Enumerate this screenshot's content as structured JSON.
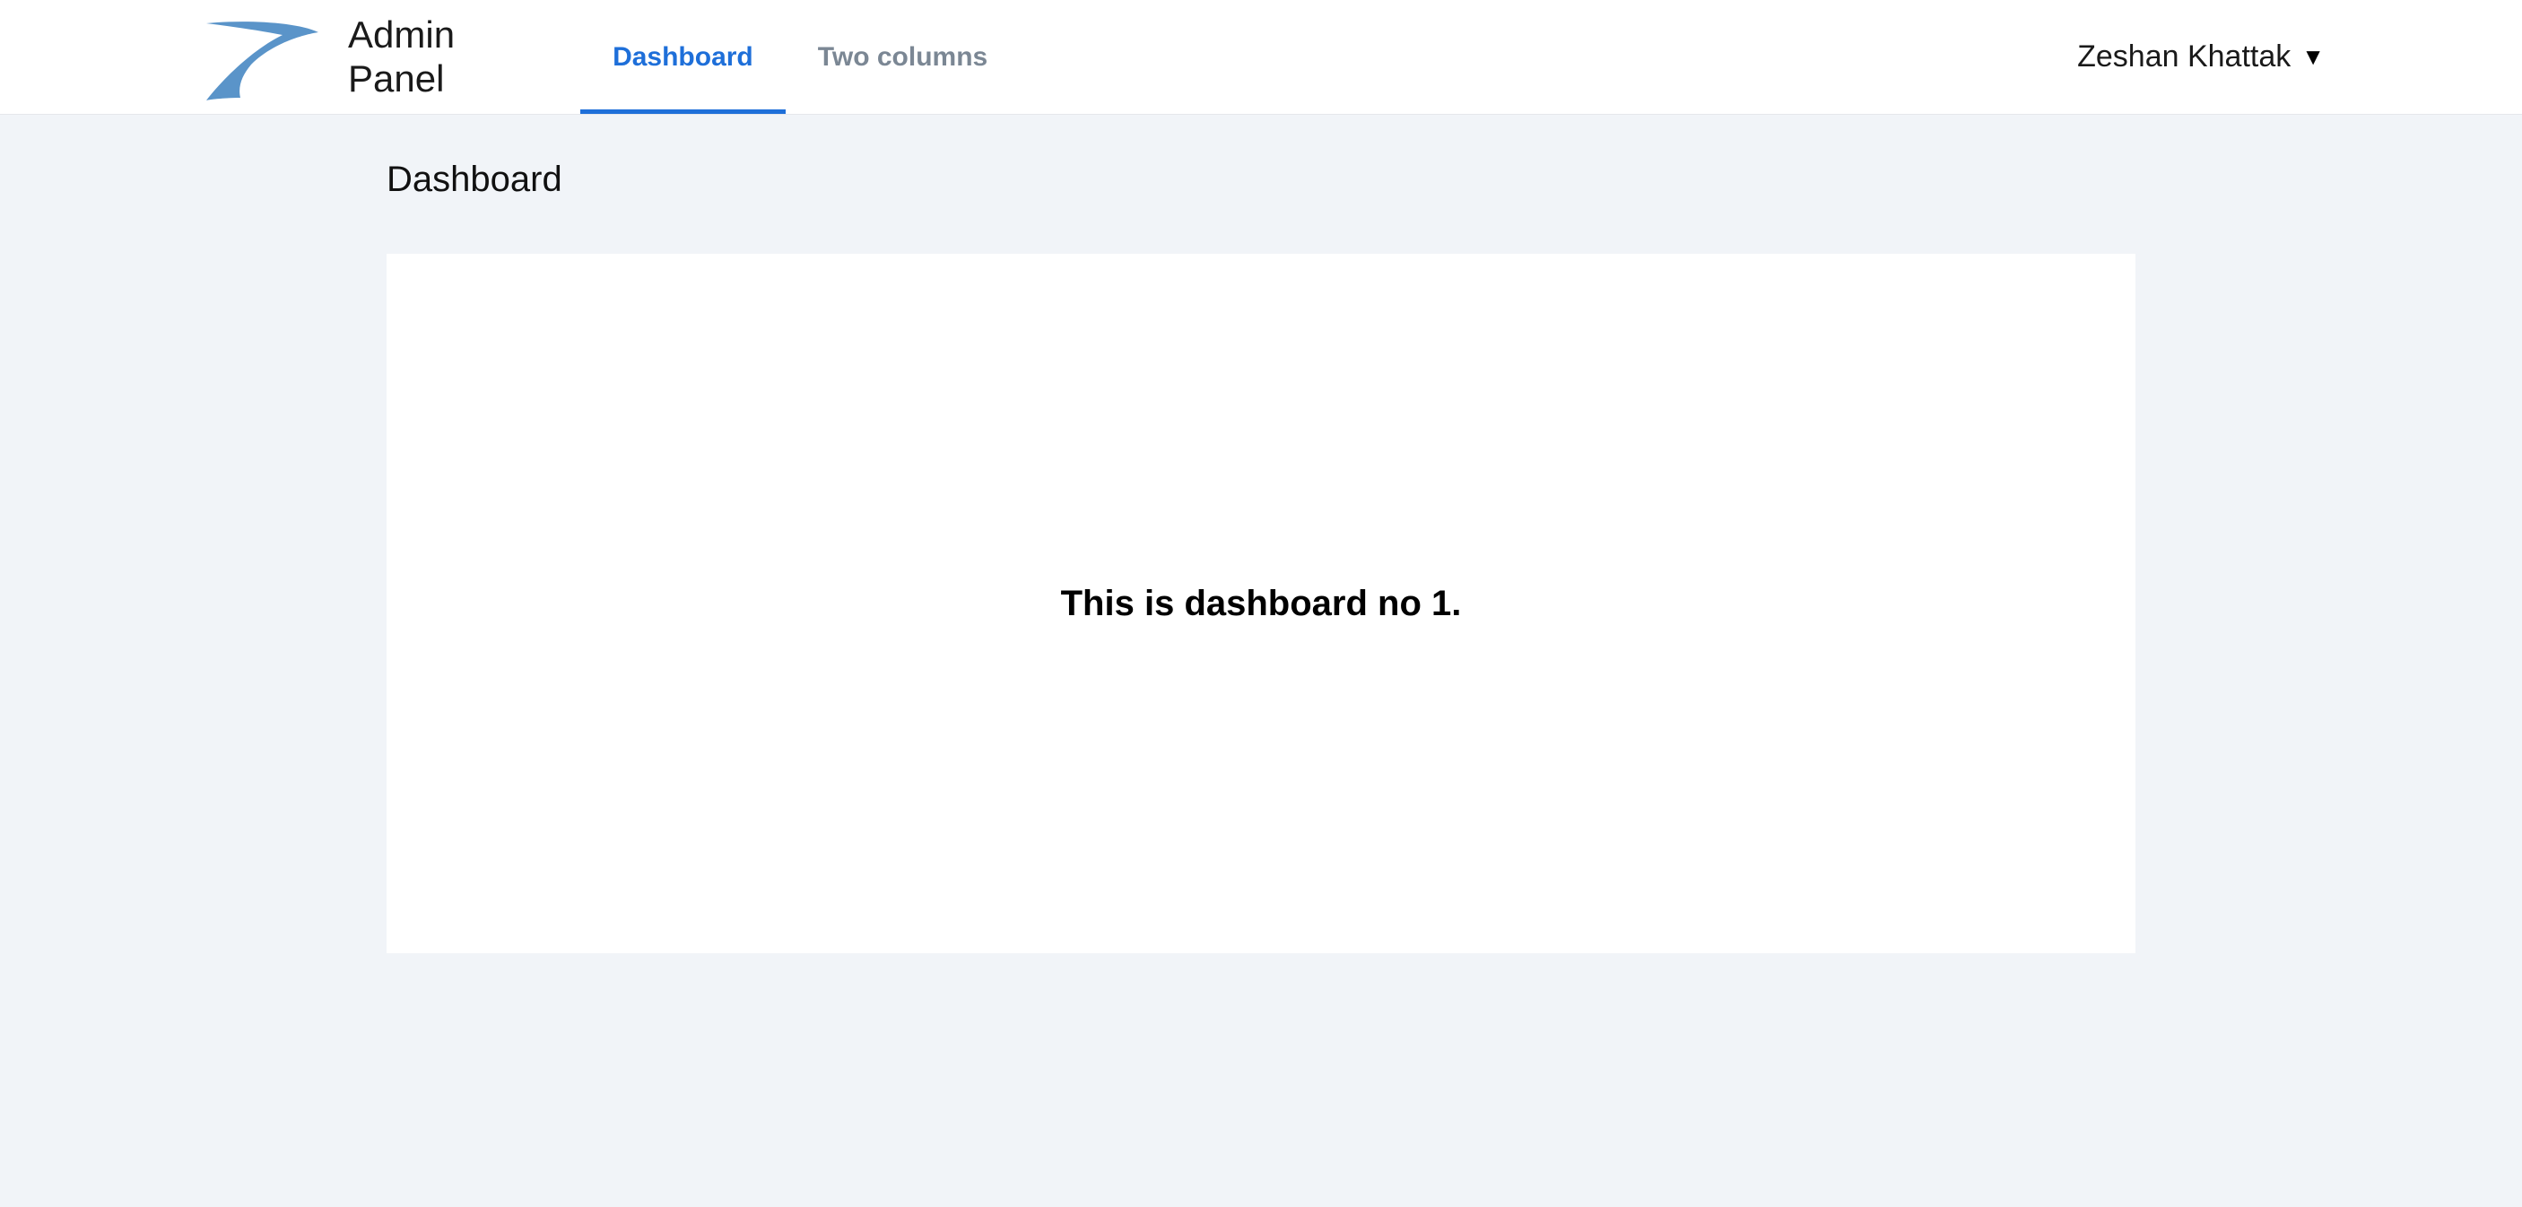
{
  "brand": {
    "line1": "Admin",
    "line2": "Panel"
  },
  "nav": {
    "items": [
      {
        "label": "Dashboard",
        "active": true
      },
      {
        "label": "Two columns",
        "active": false
      }
    ]
  },
  "user": {
    "name": "Zeshan Khattak"
  },
  "page": {
    "title": "Dashboard",
    "card_text": "This is dashboard no 1."
  }
}
